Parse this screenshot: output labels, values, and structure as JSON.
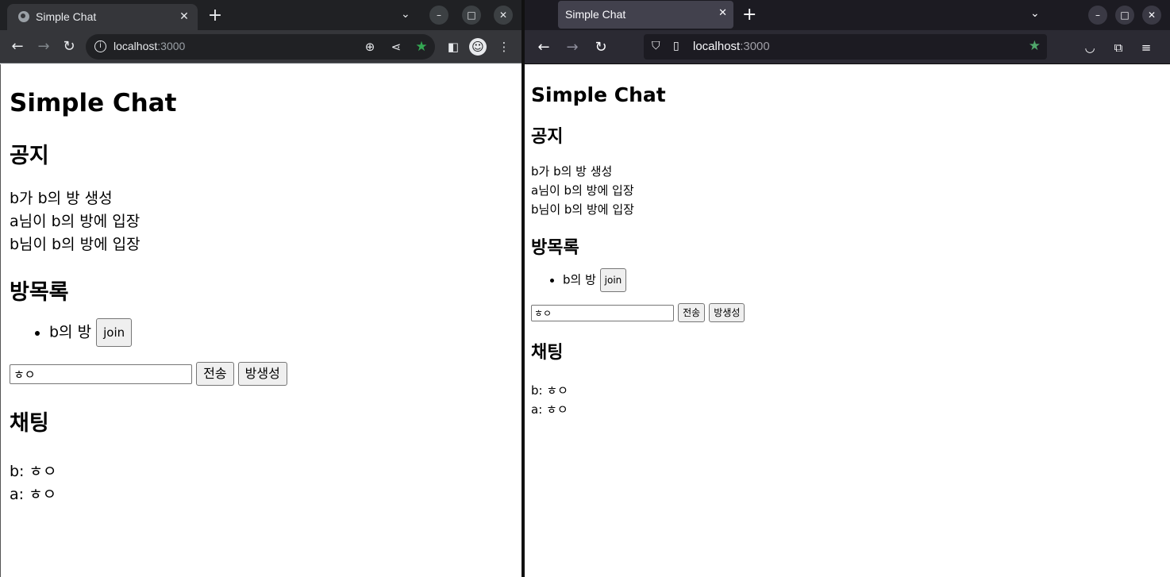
{
  "chrome": {
    "tab_title": "Simple Chat",
    "url_host": "localhost",
    "url_port": ":3000"
  },
  "firefox": {
    "tab_title": "Simple Chat",
    "url_host": "localhost",
    "url_port": ":3000"
  },
  "page": {
    "title": "Simple Chat",
    "notice_heading": "공지",
    "notices": [
      "b가 b의 방 생성",
      "a님이 b의 방에 입장",
      "b님이 b의 방에 입장"
    ],
    "rooms_heading": "방목록",
    "rooms": [
      {
        "name": "b의 방",
        "join_label": "join"
      }
    ],
    "message_input_value": "ㅎㅇ",
    "send_label": "전송",
    "create_room_label": "방생성",
    "chat_heading": "채팅",
    "messages": [
      "b: ㅎㅇ",
      "a: ㅎㅇ"
    ]
  },
  "icons": {
    "globe": "globe-icon",
    "close": "close-icon",
    "plus": "plus-icon",
    "back": "back-arrow-icon",
    "forward": "forward-arrow-icon",
    "reload": "reload-icon",
    "info": "info-icon",
    "zoom": "zoom-icon",
    "share": "share-icon",
    "star": "star-icon",
    "sidepanel": "side-panel-icon",
    "profile": "profile-avatar-icon",
    "menu": "kebab-menu-icon",
    "shield": "shield-icon",
    "pocket": "pocket-icon",
    "extensions": "extensions-icon",
    "hamburger": "hamburger-menu-icon"
  },
  "colors": {
    "bookmark_star_chrome": "#34a853",
    "bookmark_star_firefox": "#50a76b"
  }
}
